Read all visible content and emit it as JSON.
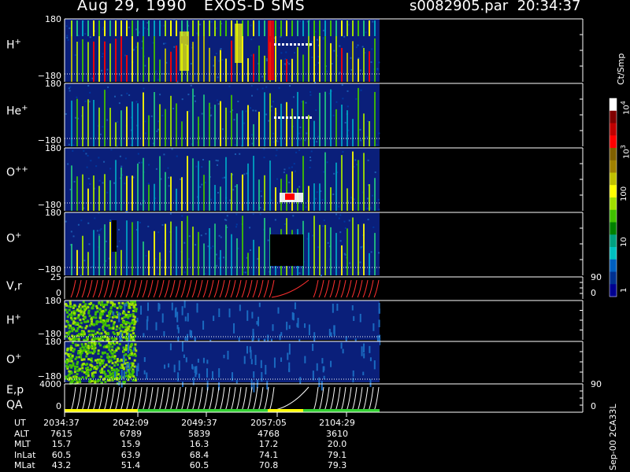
{
  "header": {
    "title": "Aug 29, 1990   EXOS-D SMS",
    "file_time": "s0082905.par  20:34:37"
  },
  "panels": [
    {
      "label": "H",
      "sup": "+",
      "ymax": "180",
      "ymin": "−180"
    },
    {
      "label": "He",
      "sup": "+",
      "ymax": "180",
      "ymin": "−180"
    },
    {
      "label": "O",
      "sup": "++",
      "ymax": "180",
      "ymin": "−180"
    },
    {
      "label": "O",
      "sup": "+",
      "ymax": "180",
      "ymin": "−180"
    },
    {
      "label": "V,r",
      "sup": "",
      "ymax": "25",
      "ymin": "0",
      "right_max": "90",
      "right_min": "0"
    },
    {
      "label": "H",
      "sup": "+",
      "ymax": "180",
      "ymin": "−180"
    },
    {
      "label": "O",
      "sup": "+",
      "ymax": "180",
      "ymin": "−180"
    },
    {
      "label": "E,p",
      "sup": "",
      "label2": "QA",
      "ymax": "4000",
      "ymin": "0",
      "right_max": "90",
      "right_min": "0"
    }
  ],
  "colorbar": {
    "units": "Ct/Smp",
    "ticks": [
      {
        "text": "10",
        "sup": "4"
      },
      {
        "text": "10",
        "sup": "3"
      },
      {
        "text": "100",
        "sup": ""
      },
      {
        "text": "10",
        "sup": ""
      },
      {
        "text": "1",
        "sup": ""
      }
    ],
    "colors": [
      "#ffffff",
      "#800000",
      "#c00000",
      "#ff0000",
      "#806000",
      "#a08000",
      "#c0c000",
      "#ffff00",
      "#a0e000",
      "#40c000",
      "#008000",
      "#00a080",
      "#00c0c0",
      "#0060c0",
      "#003090",
      "#000090"
    ]
  },
  "footer": {
    "row_labels": [
      "UT",
      "ALT",
      "MLT",
      "InLat",
      "MLat"
    ],
    "columns": [
      [
        "2034:37",
        "7615",
        "15.7",
        "60.5",
        "43.2"
      ],
      [
        "2042:09",
        "6789",
        "15.9",
        "63.9",
        "51.4"
      ],
      [
        "2049:37",
        "5839",
        "16.3",
        "68.4",
        "60.5"
      ],
      [
        "2057:05",
        "4768",
        "17.2",
        "74.1",
        "70.8"
      ],
      [
        "2104:29",
        "3610",
        "20.0",
        "79.1",
        "79.3"
      ]
    ]
  },
  "side_text": "Sep-00  2CA33L",
  "chart_data": [
    {
      "type": "heatmap",
      "title": "H+",
      "y_range": [
        -180,
        180
      ],
      "x_range": [
        "2034:37",
        "2104:29"
      ]
    },
    {
      "type": "heatmap",
      "title": "He+",
      "y_range": [
        -180,
        180
      ],
      "x_range": [
        "2034:37",
        "2104:29"
      ]
    },
    {
      "type": "heatmap",
      "title": "O++",
      "y_range": [
        -180,
        180
      ],
      "x_range": [
        "2034:37",
        "2104:29"
      ]
    },
    {
      "type": "heatmap",
      "title": "O+",
      "y_range": [
        -180,
        180
      ],
      "x_range": [
        "2034:37",
        "2104:29"
      ]
    },
    {
      "type": "line",
      "title": "V,r",
      "y_range": [
        0,
        25
      ],
      "y2_range": [
        0,
        90
      ]
    },
    {
      "type": "heatmap",
      "title": "H+",
      "y_range": [
        -180,
        180
      ],
      "x_range": [
        "2034:37",
        "2104:29"
      ]
    },
    {
      "type": "heatmap",
      "title": "O+",
      "y_range": [
        -180,
        180
      ],
      "x_range": [
        "2034:37",
        "2104:29"
      ]
    },
    {
      "type": "line",
      "title": "E,p",
      "y_range": [
        0,
        4000
      ],
      "y2_range": [
        0,
        90
      ]
    }
  ]
}
